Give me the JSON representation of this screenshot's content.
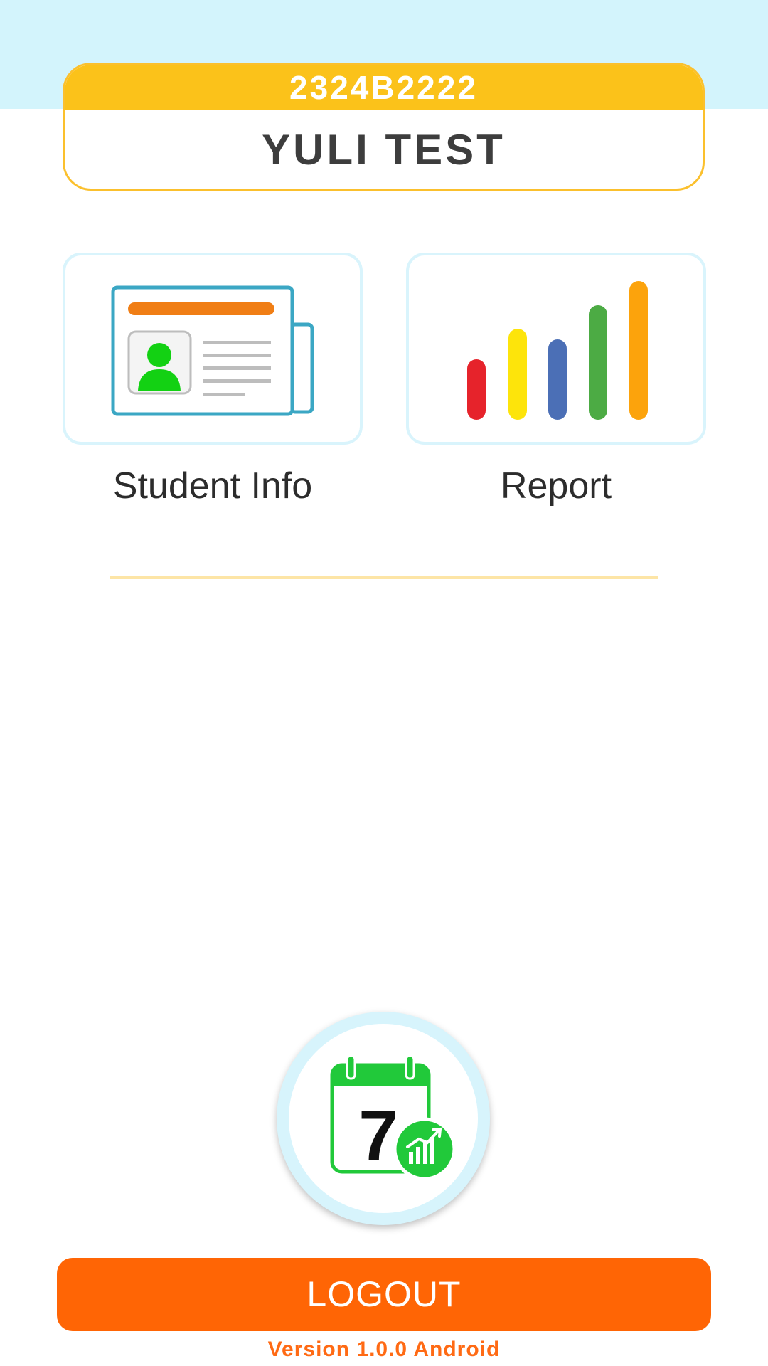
{
  "header": {
    "student_id": "2324B2222",
    "student_name": "YULI TEST"
  },
  "menu": {
    "items": [
      {
        "label": "Student Info",
        "icon": "student-id-card-icon"
      },
      {
        "label": "Report",
        "icon": "bar-chart-icon"
      }
    ]
  },
  "fab": {
    "icon": "calendar-stats-icon",
    "calendar_day": "7"
  },
  "footer": {
    "logout_label": "LOGOUT",
    "version": "Version 1.0.0 Android"
  },
  "colors": {
    "top_band": "#d3f4fc",
    "id_strip": "#fbc21a",
    "tile_border": "#d9f4fc",
    "logout": "#ff6505",
    "version_text": "#ff6a14",
    "accent_green": "#21c93a"
  }
}
